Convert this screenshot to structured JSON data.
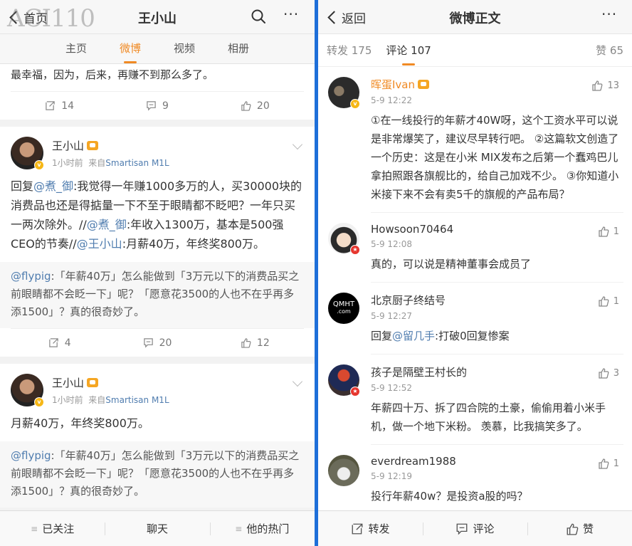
{
  "left": {
    "header": {
      "back_label": "首页",
      "title": "王小山",
      "watermark": "ACI110"
    },
    "tabs": [
      "主页",
      "微博",
      "视频",
      "相册"
    ],
    "post0": {
      "snippet": "最幸福，因为，后来，再赚不到那么多了。",
      "repost": "14",
      "comment": "9",
      "like": "20"
    },
    "post1": {
      "name": "王小山",
      "time": "1小时前",
      "source_prefix": "来自",
      "source": "Smartisan M1L",
      "t1": "回复",
      "m1": "@煮_御",
      "t2": ":我觉得一年赚1000多万的人，买30000块的消费品也还是得掂量一下不至于眼睛都不眨吧？一年只买一两次除外。//",
      "m2": "@煮_御",
      "t3": ":年收入1300万，基本是500强CEO的节奏//",
      "m3": "@王小山",
      "t4": ":月薪40万，年终奖800万。",
      "rp_mention": "@flypig",
      "rp_text": ":「年薪40万」怎么能做到「3万元以下的消费品买之前眼睛都不会眨一下」呢？「愿意花3500的人也不在乎再多添1500」？真的很奇妙了。",
      "repost": "4",
      "comment": "20",
      "like": "12"
    },
    "post2": {
      "name": "王小山",
      "time": "1小时前",
      "source_prefix": "来自",
      "source": "Smartisan M1L",
      "text": "月薪40万，年终奖800万。",
      "rp_mention": "@flypig",
      "rp_text": ":「年薪40万」怎么能做到「3万元以下的消费品买之前眼睛都不会眨一下」呢？「愿意花3500的人也不在乎再多添1500」？真的很奇妙了。"
    },
    "bottom": [
      "已关注",
      "聊天",
      "他的热门"
    ]
  },
  "right": {
    "header": {
      "back_label": "返回",
      "title": "微博正文"
    },
    "tabs": {
      "repost": "转发 175",
      "comment": "评论 107",
      "like": "赞 65"
    },
    "comments": [
      {
        "name": "晖蛋Ivan",
        "time": "5-9 12:22",
        "likes": "13",
        "text": "①在一线投行的年薪才40W呀，这个工资水平可以说是非常爆笑了，建议尽早转行吧。 ②这篇软文创造了一个历史：这是在小米 MIX发布之后第一个蠢鸡巴儿拿拍照跟各旗舰比的，给自己加戏不少。 ③你知道小米接下来不会有卖5千的旗舰的产品布局？"
      },
      {
        "name": "Howsoon70464",
        "time": "5-9 12:08",
        "likes": "1",
        "text": "真的，可以说是精神董事会成员了"
      },
      {
        "name": "北京厨子终结号",
        "time": "5-9 12:27",
        "likes": "1",
        "t_prefix": "回复",
        "mention": "@留几手",
        "text": ":打破0回复惨案",
        "avatar_text": "QMHT",
        "avatar_sub": ".com"
      },
      {
        "name": "孩子是隔壁王村长的",
        "time": "5-9 12:52",
        "likes": "3",
        "text": "年薪四十万、拆了四合院的土豪，偷偷用着小米手机，做一个地下米粉。 羡慕，比我搞笑多了。"
      },
      {
        "name": "everdream1988",
        "time": "5-9 12:19",
        "likes": "1",
        "text": "投行年薪40w？是投资a股的吗？"
      }
    ],
    "bottom": [
      "转发",
      "评论",
      "赞"
    ]
  },
  "colors": {
    "accent": "#f08a24",
    "link": "#507daf",
    "divider": "#1e6fd9"
  }
}
